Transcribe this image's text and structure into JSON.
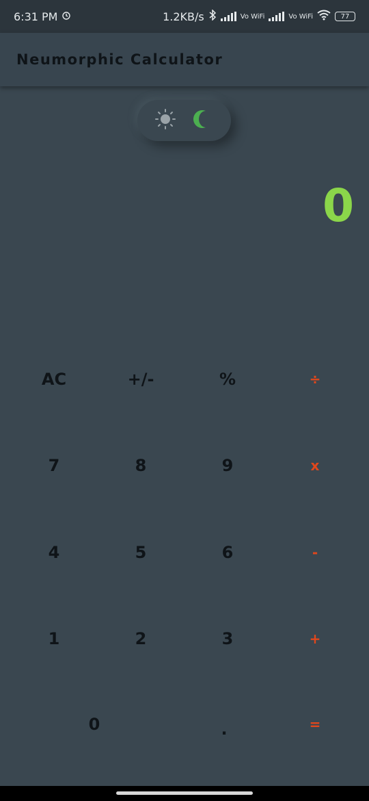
{
  "status_bar": {
    "time": "6:31 PM",
    "net_speed": "1.2KB/s",
    "sim1_label": "Vo WiFi",
    "sim2_label": "Vo WiFi",
    "battery": "77"
  },
  "app_bar": {
    "title": "Neumorphic Calculator"
  },
  "theme_toggle": {
    "light_icon": "sun-icon",
    "dark_icon": "moon-icon",
    "active": "dark",
    "active_color": "#4caf50"
  },
  "display": {
    "value": "0",
    "color": "#8bd64a"
  },
  "keypad": {
    "rows": [
      [
        "AC",
        "+/-",
        "%",
        "÷"
      ],
      [
        "7",
        "8",
        "9",
        "x"
      ],
      [
        "4",
        "5",
        "6",
        "-"
      ],
      [
        "1",
        "2",
        "3",
        "+"
      ],
      [
        "0",
        ".",
        "="
      ]
    ],
    "operator_color": "#e0471c"
  }
}
